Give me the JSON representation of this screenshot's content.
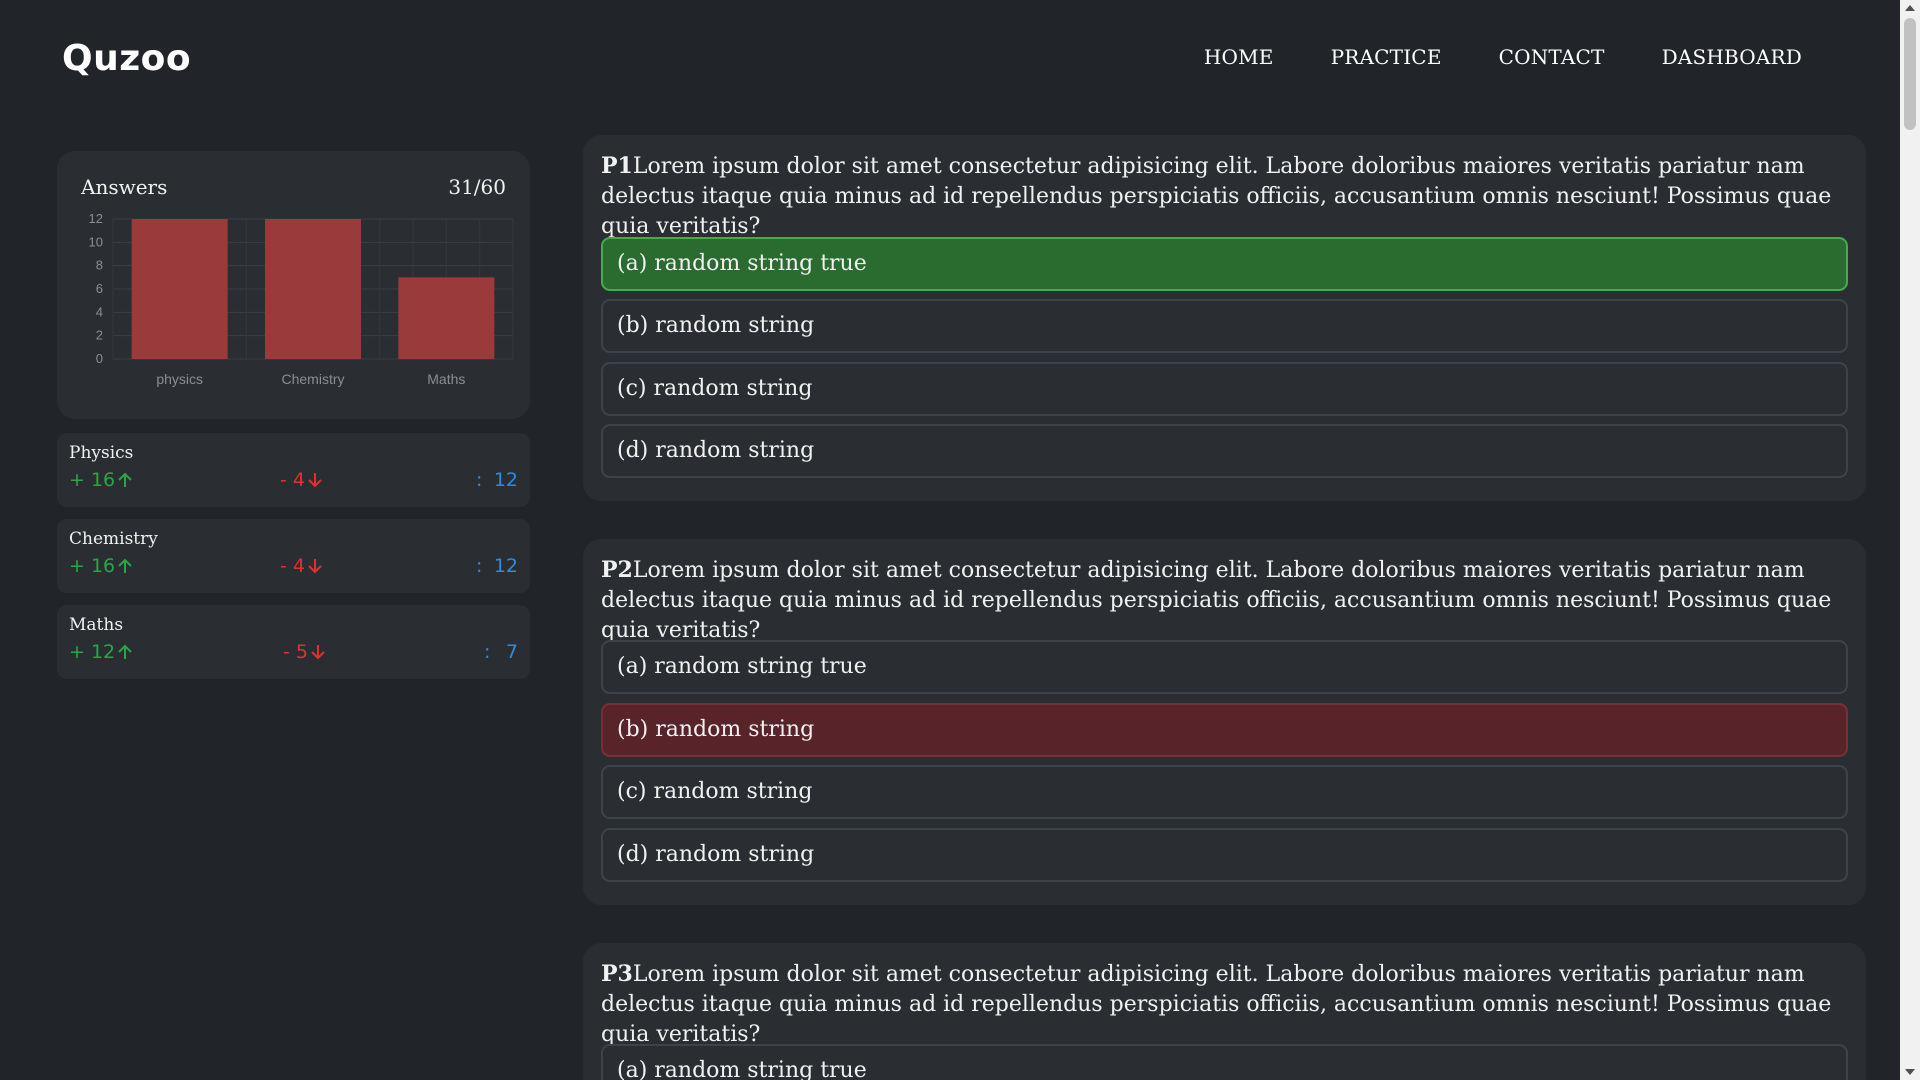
{
  "header": {
    "logo": "Quzoo",
    "nav": [
      "HOME",
      "PRACTICE",
      "CONTACT",
      "DASHBOARD"
    ]
  },
  "sidebar": {
    "chart_title": "Answers",
    "score": "31/60",
    "stats": [
      {
        "name": "Physics",
        "correct": "+ 16",
        "wrong": "- 4",
        "colon": ":",
        "total": "12"
      },
      {
        "name": "Chemistry",
        "correct": "+ 16",
        "wrong": "- 4",
        "colon": ":",
        "total": "12"
      },
      {
        "name": "Maths",
        "correct": "+ 12",
        "wrong": "- 5",
        "colon": ":",
        "total": "7"
      }
    ]
  },
  "chart_data": {
    "type": "bar",
    "categories": [
      "physics",
      "Chemistry",
      "Maths"
    ],
    "values": [
      12,
      12,
      7
    ],
    "ylim": [
      0,
      12
    ],
    "yticks": [
      0,
      2,
      4,
      6,
      8,
      10,
      12
    ],
    "grid": true,
    "bar_color": "#9b3a3a"
  },
  "questions": [
    {
      "label": "P1",
      "text": "Lorem ipsum dolor sit amet consectetur adipisicing elit. Labore doloribus maiores veritatis pariatur nam delectus itaque quia minus ad id repellendus perspiciatis officiis, accusantium omnis nesciunt! Possimus quae quia veritatis?",
      "options": [
        "(a) random string true",
        "(b) random string",
        "(c) random string",
        "(d) random string"
      ],
      "states": [
        "correct",
        "",
        "",
        ""
      ]
    },
    {
      "label": "P2",
      "text": "Lorem ipsum dolor sit amet consectetur adipisicing elit. Labore doloribus maiores veritatis pariatur nam delectus itaque quia minus ad id repellendus perspiciatis officiis, accusantium omnis nesciunt! Possimus quae quia veritatis?",
      "options": [
        "(a) random string true",
        "(b) random string",
        "(c) random string",
        "(d) random string"
      ],
      "states": [
        "",
        "wrong",
        "",
        ""
      ]
    },
    {
      "label": "P3",
      "text": "Lorem ipsum dolor sit amet consectetur adipisicing elit. Labore doloribus maiores veritatis pariatur nam delectus itaque quia minus ad id repellendus perspiciatis officiis, accusantium omnis nesciunt! Possimus quae quia veritatis?",
      "options": [
        "(a) random string true"
      ],
      "states": [
        ""
      ]
    }
  ],
  "colors": {
    "background": "#212529",
    "card": "#2a2e33",
    "correct": "#2a6b2f",
    "wrong": "#582429",
    "positive": "#28a745",
    "negative": "#e03131",
    "total": "#2b8ce6"
  }
}
